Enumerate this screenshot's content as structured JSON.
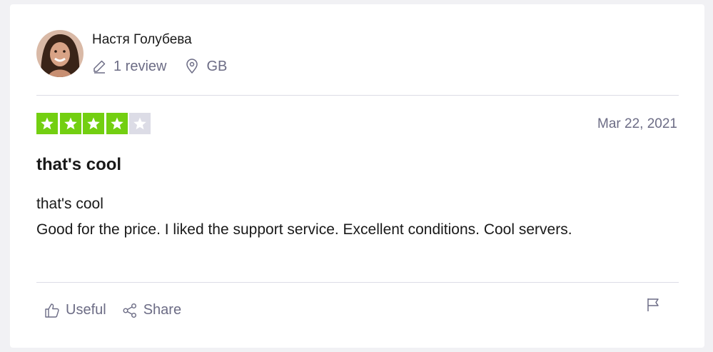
{
  "reviewer": {
    "name": "Настя Голубева",
    "review_count": "1 review",
    "country": "GB"
  },
  "review": {
    "rating": 4,
    "rating_max": 5,
    "date": "Mar 22, 2021",
    "title": "that's cool",
    "body_lines": [
      "that's cool",
      "Good for the price. I liked the support service. Excellent conditions. Cool servers."
    ]
  },
  "actions": {
    "useful_label": "Useful",
    "share_label": "Share"
  },
  "colors": {
    "star_on": "#73cf11",
    "star_off": "#dcdce6",
    "muted_text": "#6c6c85"
  },
  "icons": [
    "pencil-icon",
    "location-pin-icon",
    "star-icon",
    "thumbs-up-icon",
    "share-icon",
    "flag-icon"
  ]
}
